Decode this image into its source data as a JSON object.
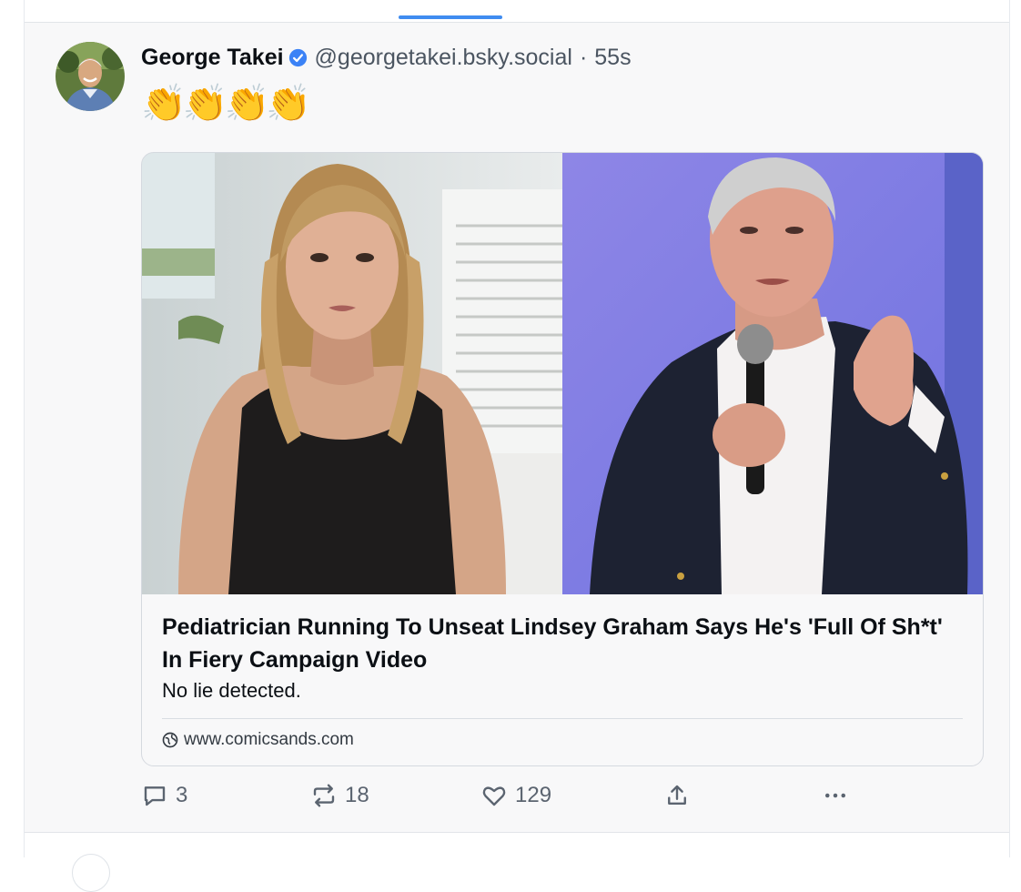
{
  "post": {
    "author": {
      "display_name": "George Takei",
      "handle": "@georgetakei.bsky.social",
      "verified_icon": "verified-badge-icon"
    },
    "separator": "·",
    "time": "55s",
    "text": "👏👏👏👏",
    "embed": {
      "title": "Pediatrician Running To Unseat Lindsey Graham Says He's 'Full Of Sh*t' In Fiery Campaign Video",
      "description": "No lie detected.",
      "domain": "www.comicsands.com",
      "domain_icon": "globe-icon"
    },
    "actions": {
      "reply": {
        "icon": "comment-icon",
        "count": "3"
      },
      "repost": {
        "icon": "repost-icon",
        "count": "18"
      },
      "like": {
        "icon": "heart-icon",
        "count": "129"
      },
      "share": {
        "icon": "share-icon"
      },
      "more": {
        "icon": "more-icon"
      }
    }
  },
  "colors": {
    "accent": "#3f8cf0",
    "verified": "#3b82f6",
    "muted_text": "#4b5561",
    "post_background": "#f8f8f9"
  }
}
